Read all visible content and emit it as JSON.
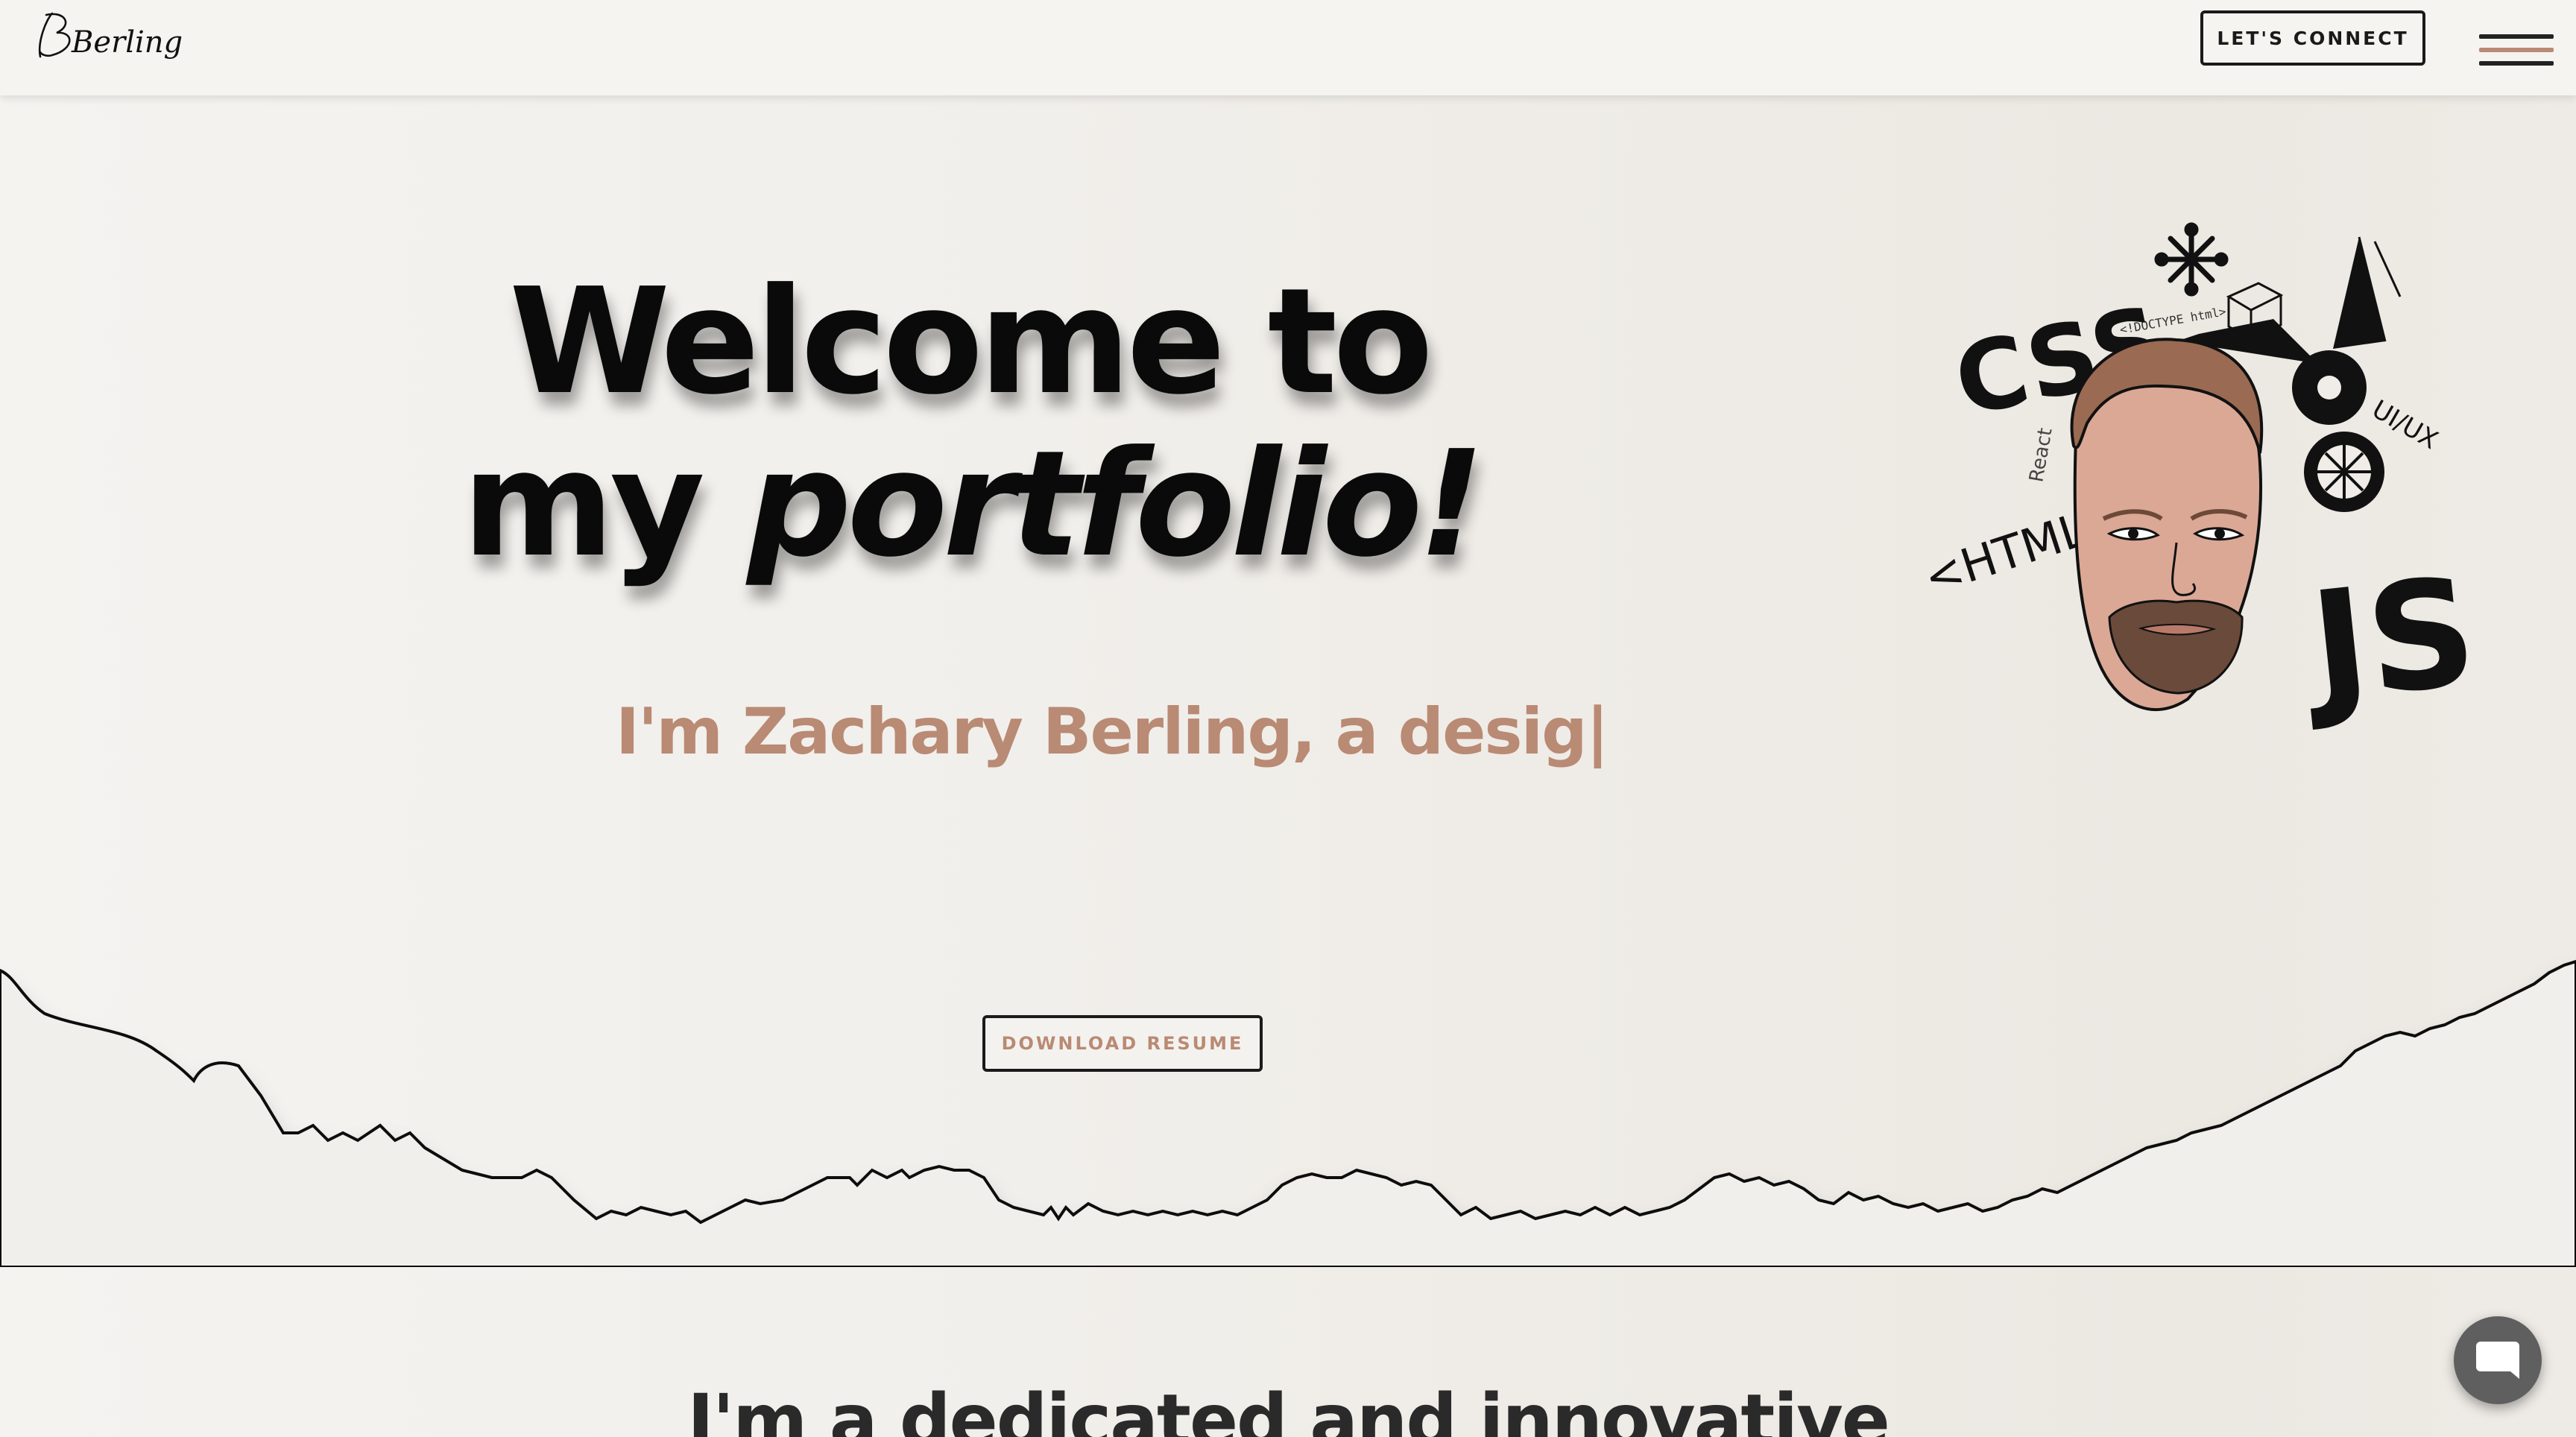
{
  "header": {
    "logo_text": "Berling",
    "connect_label": "LET'S CONNECT",
    "menu_icon": "hamburger-menu-icon"
  },
  "hero": {
    "title_line1": "Welcome to",
    "title_line2_regular": "my",
    "title_line2_italic": "portfolio!",
    "typed_text": "I'm Zachary Berling, a desig",
    "typed_cursor": "|",
    "illustration_labels": {
      "css": "CSS",
      "html": "<HTML>",
      "js": "JS",
      "uiux": "UI/UX",
      "doctype": "<!DOCTYPE html>",
      "react": "React"
    }
  },
  "resume": {
    "label": "DOWNLOAD RESUME"
  },
  "about": {
    "heading": "I'm a dedicated and innovative"
  },
  "chat": {
    "icon": "chat-bubble-icon"
  },
  "colors": {
    "accent": "#b98a74",
    "text_dark": "#0a0a0a",
    "background": "#f2f0ec"
  }
}
